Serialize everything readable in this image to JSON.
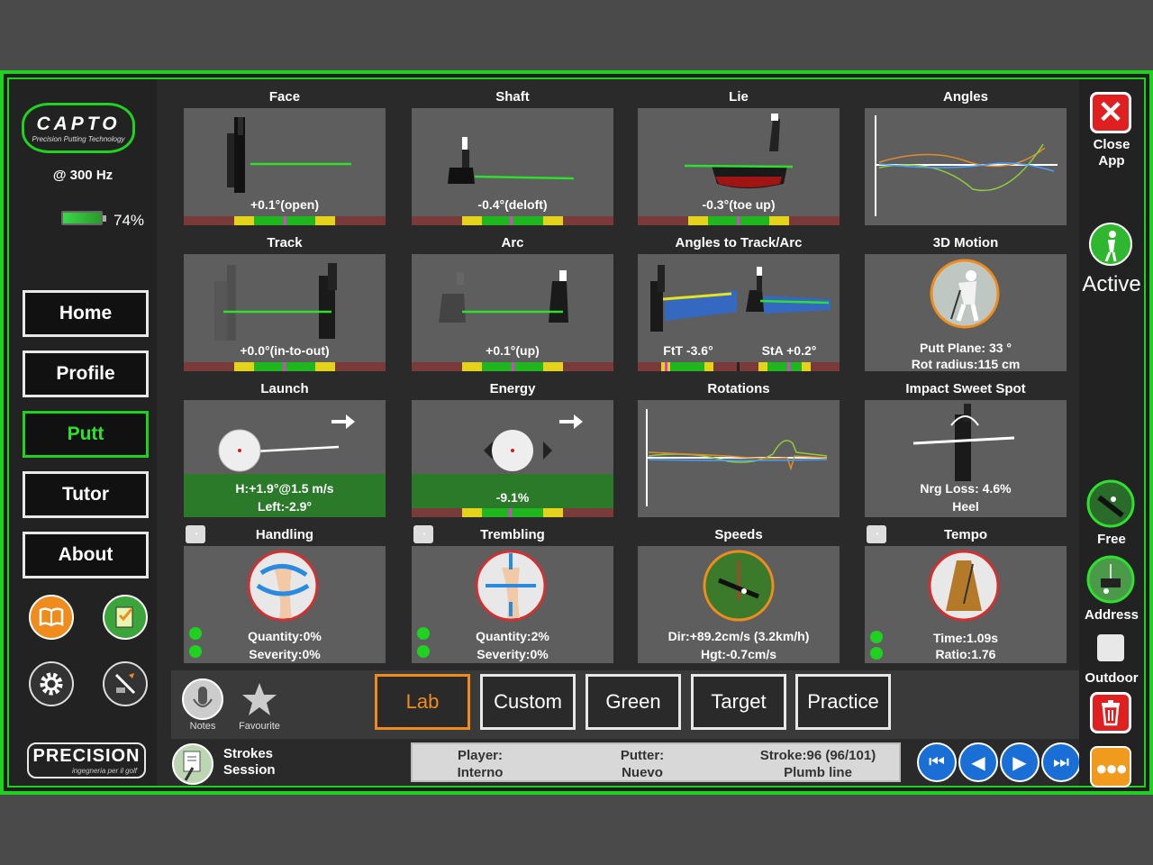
{
  "sidebar": {
    "logo_title": "CAPTO",
    "logo_subtitle": "Precision Putting Technology",
    "frequency": "@ 300 Hz",
    "battery": "74%",
    "battery_level": 0.74,
    "nav": [
      "Home",
      "Profile",
      "Putt",
      "Tutor",
      "About"
    ],
    "active_nav": "Putt",
    "brand": "PRECISION",
    "brand_sub": "ingegneria per il golf"
  },
  "panels": {
    "face": {
      "title": "Face",
      "value": "+0.1°(open)"
    },
    "shaft": {
      "title": "Shaft",
      "value": "-0.4°(deloft)"
    },
    "lie": {
      "title": "Lie",
      "value": "-0.3°(toe up)"
    },
    "angles": {
      "title": "Angles"
    },
    "track": {
      "title": "Track",
      "value": "+0.0°(in-to-out)"
    },
    "arc": {
      "title": "Arc",
      "value": "+0.1°(up)"
    },
    "angles_track": {
      "title": "Angles to Track/Arc",
      "value_left": "FtT -3.6°",
      "value_right": "StA +0.2°"
    },
    "motion3d": {
      "title": "3D Motion",
      "line1": "Putt Plane: 33 °",
      "line2": "Rot radius:115 cm"
    },
    "launch": {
      "title": "Launch",
      "line1": "H:+1.9°@1.5 m/s",
      "line2": "Left:-2.9°"
    },
    "energy": {
      "title": "Energy",
      "value": "-9.1%"
    },
    "rotations": {
      "title": "Rotations"
    },
    "sweet_spot": {
      "title": "Impact Sweet Spot",
      "line1": "Nrg Loss: 4.6%",
      "line2": "Heel"
    },
    "handling": {
      "title": "Handling",
      "line1": "Quantity:0%",
      "line2": "Severity:0%"
    },
    "trembling": {
      "title": "Trembling",
      "line1": "Quantity:2%",
      "line2": "Severity:0%"
    },
    "speeds": {
      "title": "Speeds",
      "line1": "Dir:+89.2cm/s (3.2km/h)",
      "line2": "Hgt:-0.7cm/s"
    },
    "tempo": {
      "title": "Tempo",
      "line1": "Time:1.09s",
      "line2": "Ratio:1.76"
    }
  },
  "right": {
    "close": "Close\nApp",
    "close_l1": "Close",
    "close_l2": "App",
    "active": "Active",
    "free": "Free",
    "address": "Address",
    "outdoor": "Outdoor"
  },
  "toolbar": {
    "notes": "Notes",
    "favourite": "Favourite",
    "tabs": [
      "Lab",
      "Custom",
      "Green",
      "Target",
      "Practice"
    ],
    "active_tab": "Lab"
  },
  "status": {
    "strokes": "Strokes",
    "session": "Session",
    "player_label": "Player:",
    "player": "Interno",
    "putter_label": "Putter:",
    "putter": "Nuevo",
    "stroke_label": "Stroke:96 (96/101)",
    "stroke_type": "Plumb line"
  },
  "colors": {
    "accent_green": "#1fd21f",
    "accent_orange": "#f08c1e",
    "nav_blue": "#1a6fd6"
  }
}
